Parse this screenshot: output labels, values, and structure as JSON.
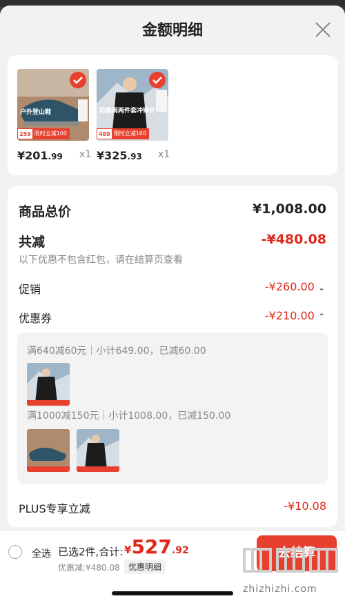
{
  "header": {
    "title": "金额明细"
  },
  "products": [
    {
      "price_int": "¥201",
      "price_dec": ".99",
      "qty": "x1",
      "tag_num": "259",
      "tag_text": "限时立减100",
      "caption": "户外登山鞋"
    },
    {
      "price_int": "¥325",
      "price_dec": ".93",
      "qty": "x1",
      "tag_num": "489",
      "tag_text": "限时立减160",
      "caption": "防暴雨两件套冲锋衣"
    }
  ],
  "summary": {
    "total_label": "商品总价",
    "total_value": "¥1,008.00",
    "reduce_label": "共减",
    "reduce_value": "-¥480.08",
    "note": "以下优惠不包含红包，请在结算页查看",
    "promo_label": "促销",
    "promo_value": "-¥260.00",
    "coupon_label": "优惠券",
    "coupon_value": "-¥210.00",
    "coupon_line1": "满640减60元｜小计649.00，已减60.00",
    "coupon_line2": "满1000减150元｜小计1008.00，已减150.00",
    "plus_label": "PLUS专享立减",
    "plus_value": "-¥10.08"
  },
  "bottom": {
    "select_all": "全选",
    "selected": "已选2件,合计:",
    "total_yen": "¥",
    "total_int": "527",
    "total_dec": ".92",
    "discount": "优惠减:¥480.08",
    "detail_button": "优惠明细",
    "checkout": "去结算"
  },
  "watermark": {
    "text": "zhizhizhi.com"
  },
  "colors": {
    "accent": "#e8402e",
    "price_red": "#e0281a"
  }
}
